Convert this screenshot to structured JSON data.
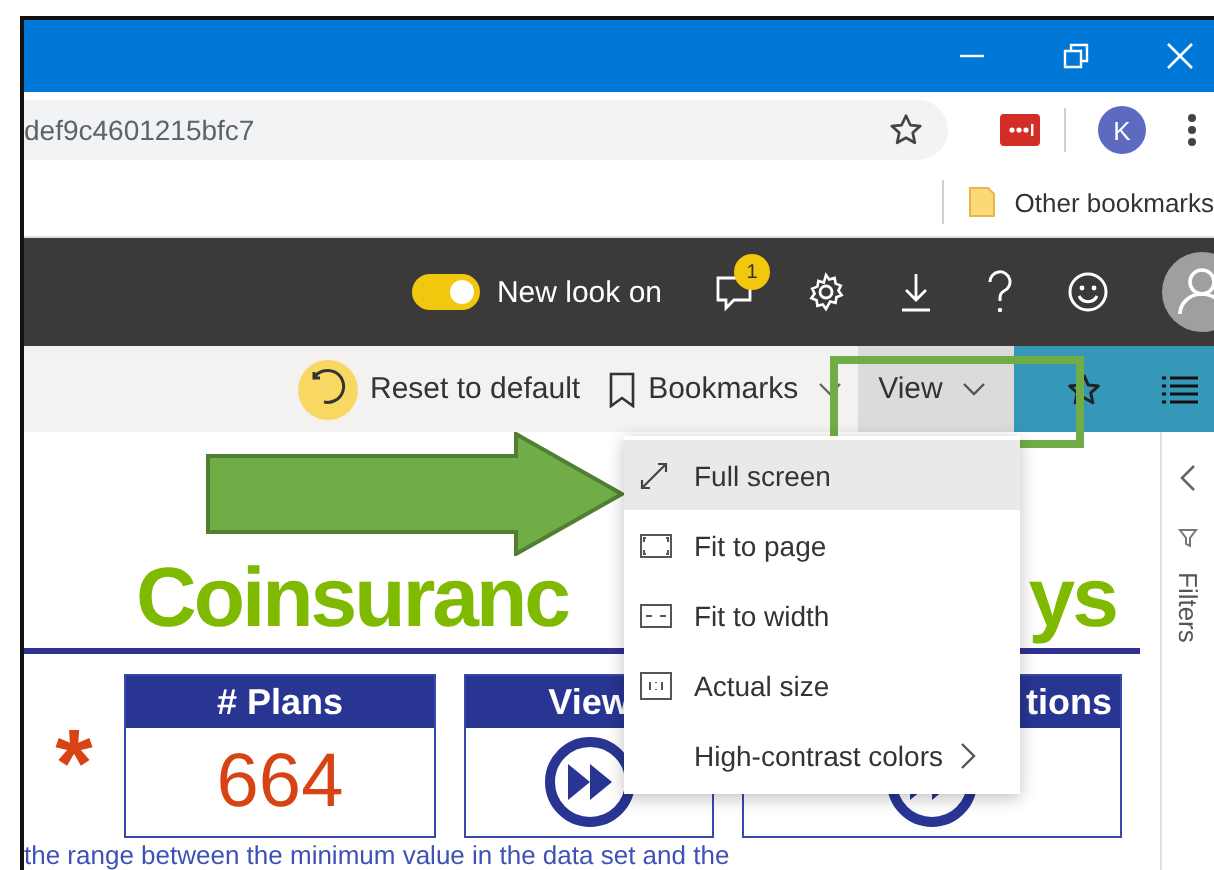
{
  "browser": {
    "address": "def9c4601215bfc7",
    "avatar_letter": "K",
    "bookmarks": [
      "Other bookmarks"
    ]
  },
  "app_header": {
    "toggle": {
      "label": "New look on",
      "on": true
    },
    "notification_count": "1"
  },
  "toolbar": {
    "reset": "Reset to default",
    "bookmarks": "Bookmarks",
    "view": {
      "label": "View",
      "expanded": true
    }
  },
  "view_menu": [
    {
      "label": "Full screen",
      "kind": "fullscreen",
      "selected": true
    },
    {
      "label": "Fit to page",
      "kind": "fitpage",
      "selected": false
    },
    {
      "label": "Fit to width",
      "kind": "fitwidth",
      "selected": false
    },
    {
      "label": "Actual size",
      "kind": "actual",
      "selected": false
    },
    {
      "label": "High-contrast colors",
      "kind": "submenu",
      "selected": false
    }
  ],
  "report": {
    "title_left": "Coinsuranc",
    "title_right": "ys",
    "marker": "*",
    "cards": [
      {
        "header": "# Plans",
        "kind": "value",
        "value": "664"
      },
      {
        "header": "View",
        "kind": "button"
      },
      {
        "header": "tions",
        "kind": "button"
      }
    ],
    "note": "the range between the minimum value in the data set and the"
  },
  "filters_pane": {
    "label": "Filters"
  }
}
